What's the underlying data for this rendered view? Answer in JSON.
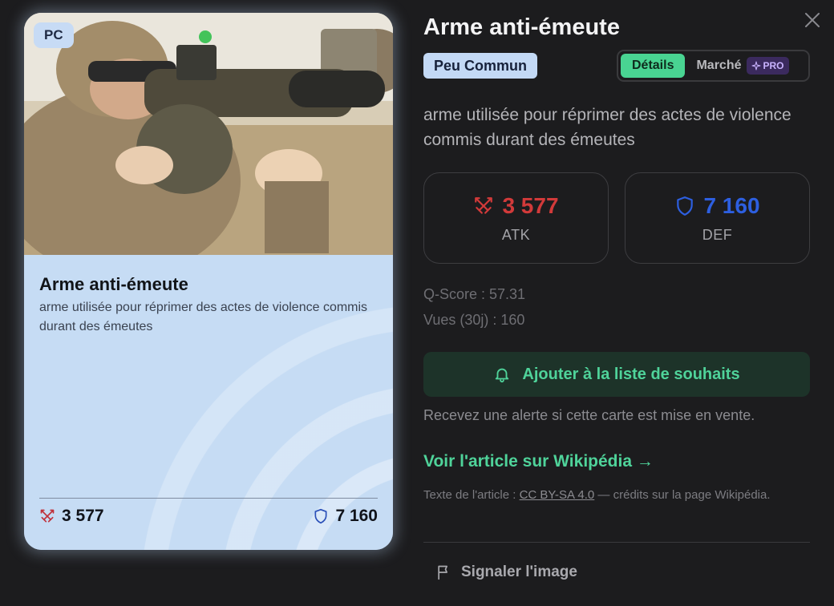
{
  "card": {
    "chip": "PC",
    "title": "Arme anti-émeute",
    "description": "arme utilisée pour réprimer des actes de violence commis durant des émeutes",
    "atk": "3 577",
    "def": "7 160"
  },
  "detail": {
    "title": "Arme anti-émeute",
    "rarity": "Peu Commun",
    "tabs": {
      "details": "Détails",
      "market": "Marché",
      "pro": "PRO"
    },
    "description": "arme utilisée pour réprimer des actes de violence commis durant des émeutes",
    "atk": {
      "value": "3 577",
      "label": "ATK"
    },
    "def": {
      "value": "7 160",
      "label": "DEF"
    },
    "q_score": "Q-Score : 57.31",
    "views": "Vues (30j) : 160",
    "wishlist_button": "Ajouter à la liste de souhaits",
    "wishlist_help": "Recevez une alerte si cette carte est mise en vente.",
    "wiki_link": "Voir l'article sur Wikipédia →",
    "license_prefix": "Texte de l'article : ",
    "license_link": "CC BY-SA 4.0",
    "license_suffix": " — crédits sur la page Wikipédia.",
    "report_button": "Signaler l'image"
  },
  "colors": {
    "accent_green": "#4fd39a",
    "atk_red": "#d23a3a",
    "def_blue": "#2d5fe0",
    "card_blue": "#c6dcf4"
  },
  "icons": [
    "close-icon",
    "swords-icon",
    "shield-icon",
    "bell-icon",
    "sparkle-icon",
    "flag-icon"
  ]
}
